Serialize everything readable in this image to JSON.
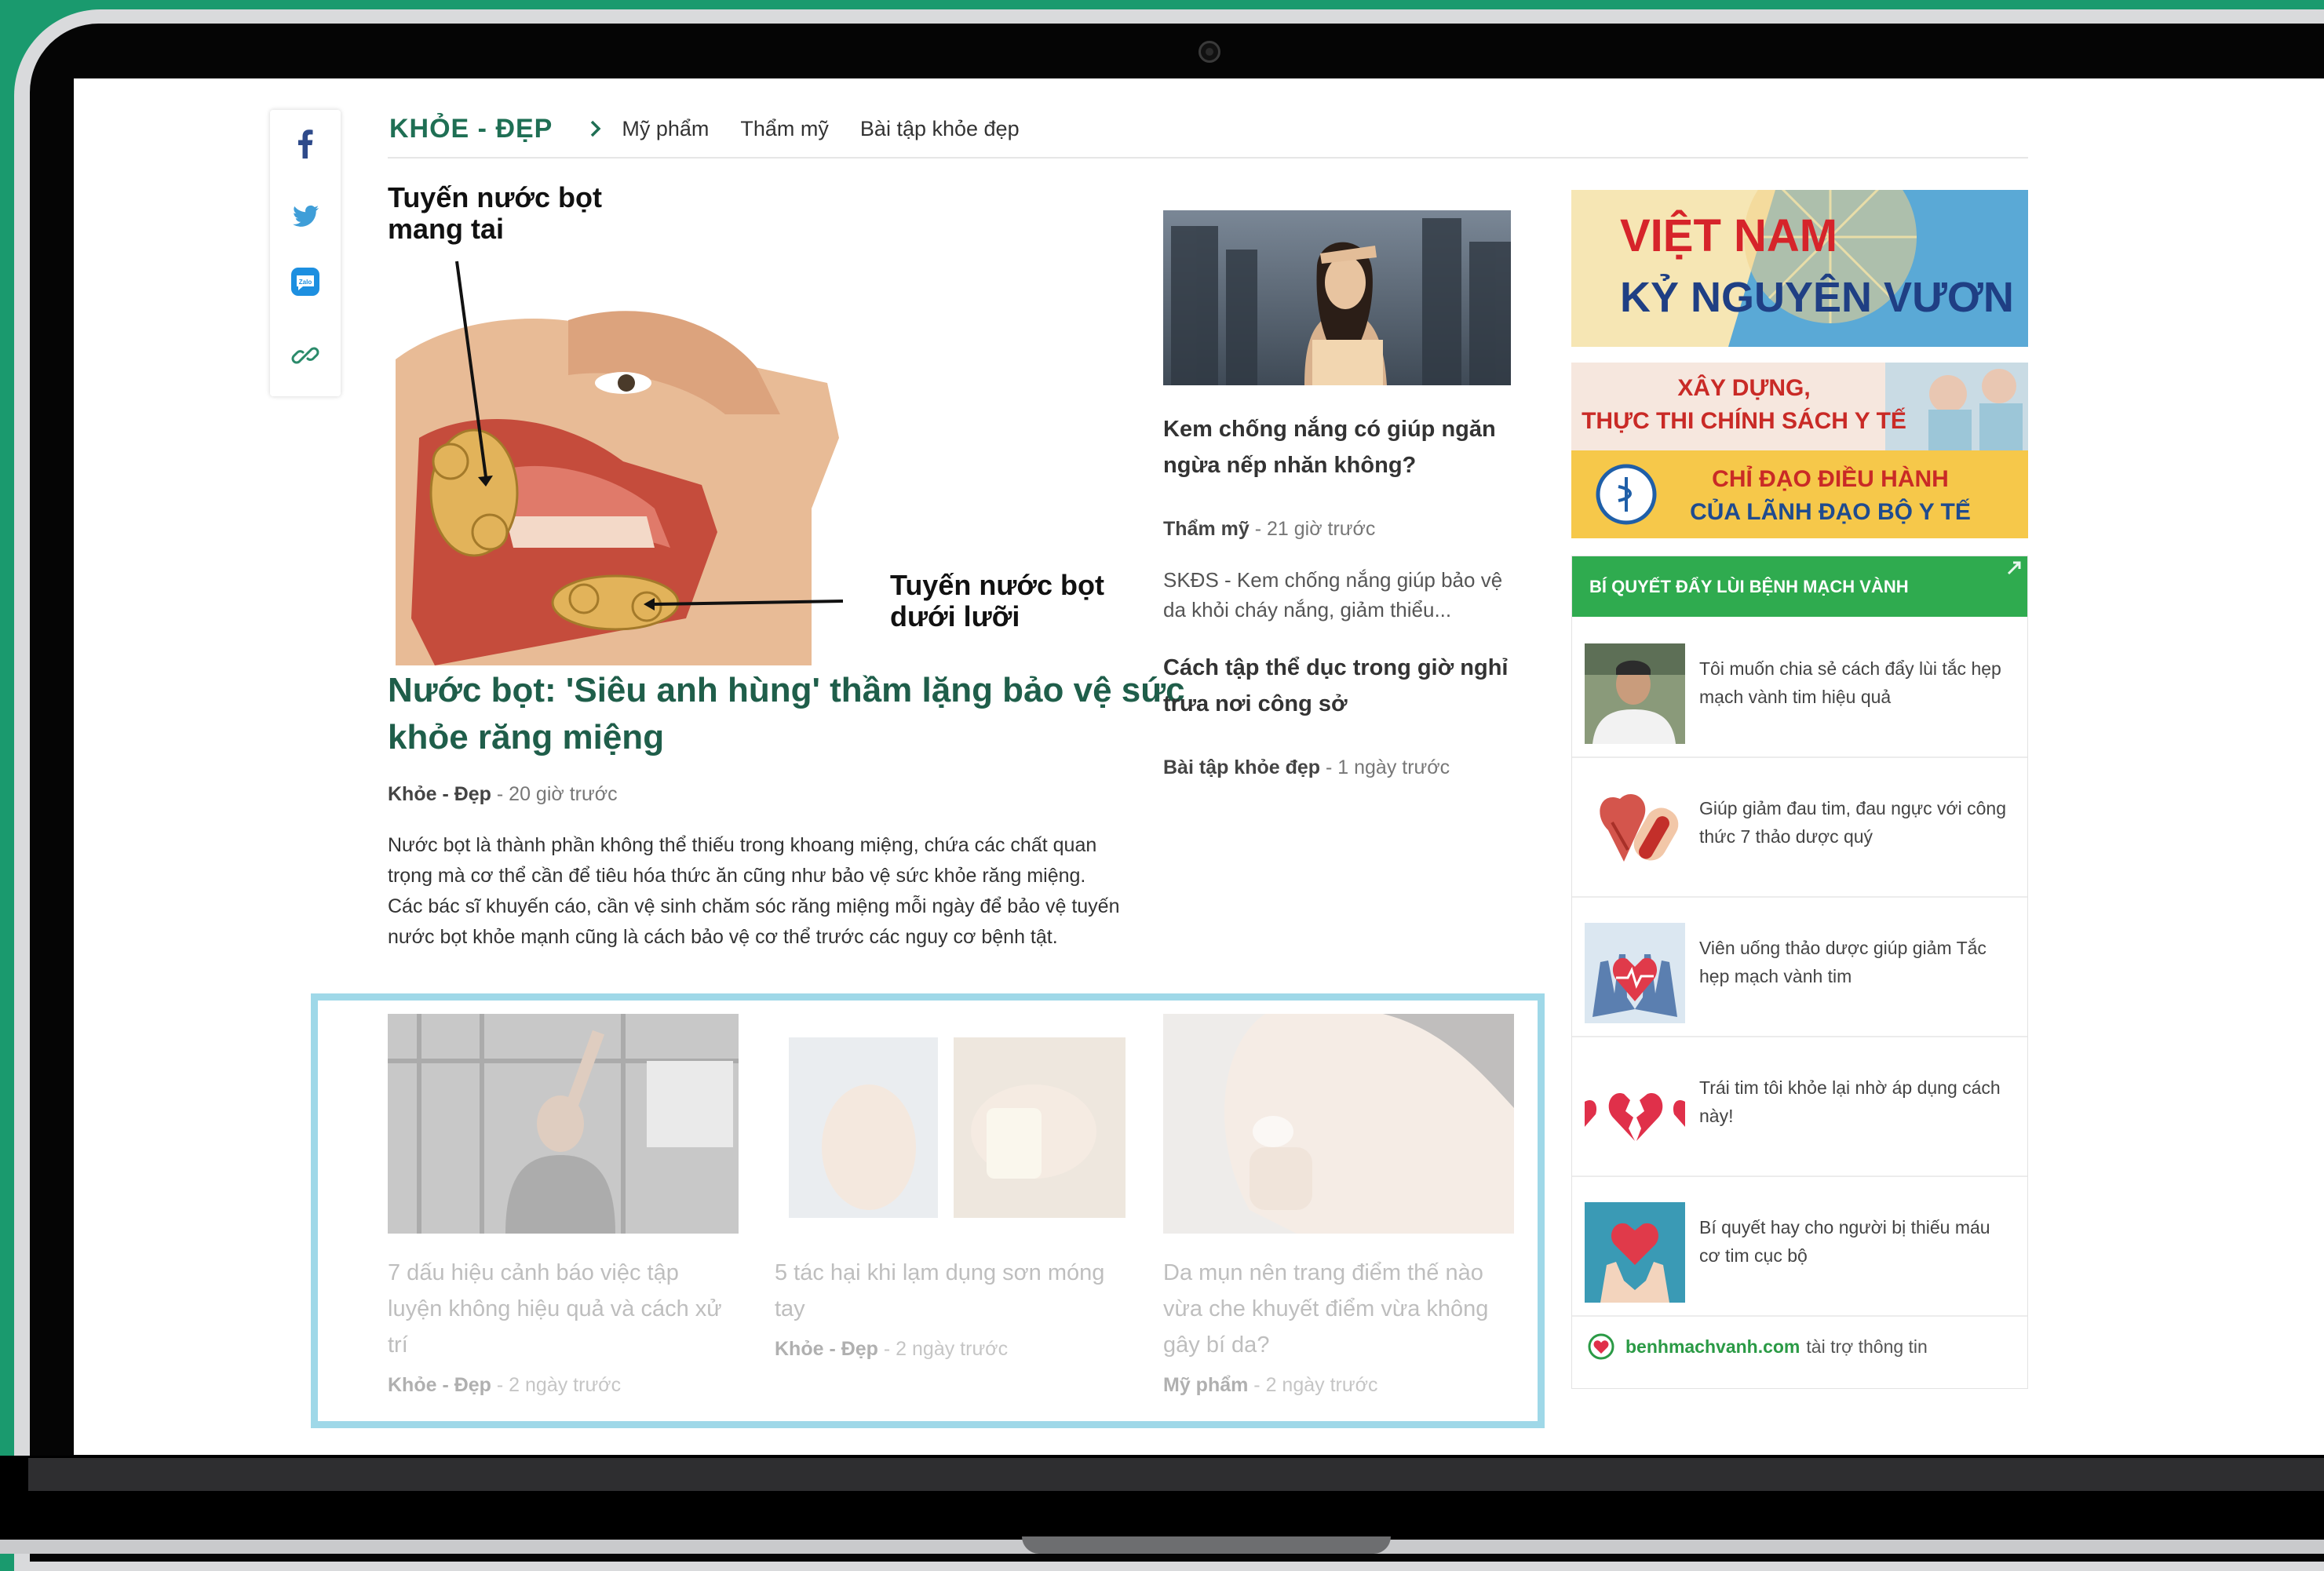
{
  "colors": {
    "accent": "#1f6f54",
    "widget_green": "#2fab4f",
    "highlight_border": "#9fd8e8",
    "frame_green": "#1a9a6e"
  },
  "share": {
    "icons": [
      "facebook-icon",
      "twitter-icon",
      "zalo-icon",
      "link-icon"
    ]
  },
  "breadcrumb": {
    "section": "KHỎE - ĐẸP",
    "items": [
      "Mỹ phẩm",
      "Thẩm mỹ",
      "Bài tập khỏe đẹp"
    ]
  },
  "lead": {
    "image_labels": {
      "top": "Tuyến nước bọt mang tai",
      "bottom": "Tuyến nước bọt dưới lưỡi"
    },
    "title": "Nước bọt: 'Siêu anh hùng' thầm lặng bảo vệ sức khỏe răng miệng",
    "category": "Khỏe - Đẹp",
    "time": " - 20 giờ trước",
    "description": "Nước bọt là thành phần không thể thiếu trong khoang miệng, chứa các chất quan trọng mà cơ thể cần để tiêu hóa thức ăn cũng như bảo vệ sức khỏe răng miệng. Các bác sĩ khuyến cáo, cần vệ sinh chăm sóc răng miệng mỗi ngày để bảo vệ tuyến nước bọt khỏe mạnh cũng là cách bảo vệ cơ thể trước các nguy cơ bệnh tật."
  },
  "side": [
    {
      "title": "Kem chống nắng có giúp ngăn ngừa nếp nhăn không?",
      "category": "Thẩm mỹ",
      "time": " - 21 giờ trước",
      "description": "SKĐS - Kem chống nắng giúp bảo vệ da khỏi cháy nắng, giảm thiểu..."
    },
    {
      "title": "Cách tập thể dục trong giờ nghỉ trưa nơi công sở",
      "category": "Bài tập khỏe đẹp",
      "time": " - 1 ngày trước"
    }
  ],
  "related": [
    {
      "title": "7 dấu hiệu cảnh báo việc tập luyện không hiệu quả và cách xử trí",
      "category": "Khỏe - Đẹp",
      "time": " - 2 ngày trước"
    },
    {
      "title": "5 tác hại khi lạm dụng sơn móng tay",
      "category": "Khỏe - Đẹp",
      "time": " - 2 ngày trước"
    },
    {
      "title": "Da mụn nên trang điểm thế nào vừa che khuyết điểm vừa không gây bí da?",
      "category": "Mỹ phẩm",
      "time": " - 2 ngày trước"
    }
  ],
  "banners": {
    "b1_line1": "VIỆT NAM",
    "b1_line2": "KỶ NGUYÊN VƯƠN MÌNH",
    "b2_line1": "XÂY DỰNG,",
    "b2_line2": "THỰC THI CHÍNH SÁCH Y TẾ",
    "b2_line3": "CHỈ ĐẠO ĐIỀU HÀNH",
    "b2_line4": "CỦA LÃNH ĐẠO BỘ Y TẾ"
  },
  "widget": {
    "title": "BÍ QUYẾT ĐẨY LÙI BỆNH MẠCH VÀNH",
    "items": [
      "Tôi muốn chia sẻ cách đẩy lùi tắc hẹp mạch vành tim hiệu quả",
      "Giúp giảm đau tim, đau ngực với công thức 7 thảo dược quý",
      "Viên uống thảo dược giúp giảm Tắc hẹp mạch vành tim",
      "Trái tim tôi khỏe lại nhờ áp dụng cách này!",
      "Bí quyết hay cho người bị thiếu máu cơ tim cục bộ"
    ],
    "footer_brand": "benhmachvanh.com",
    "footer_text": "tài trợ thông tin"
  }
}
